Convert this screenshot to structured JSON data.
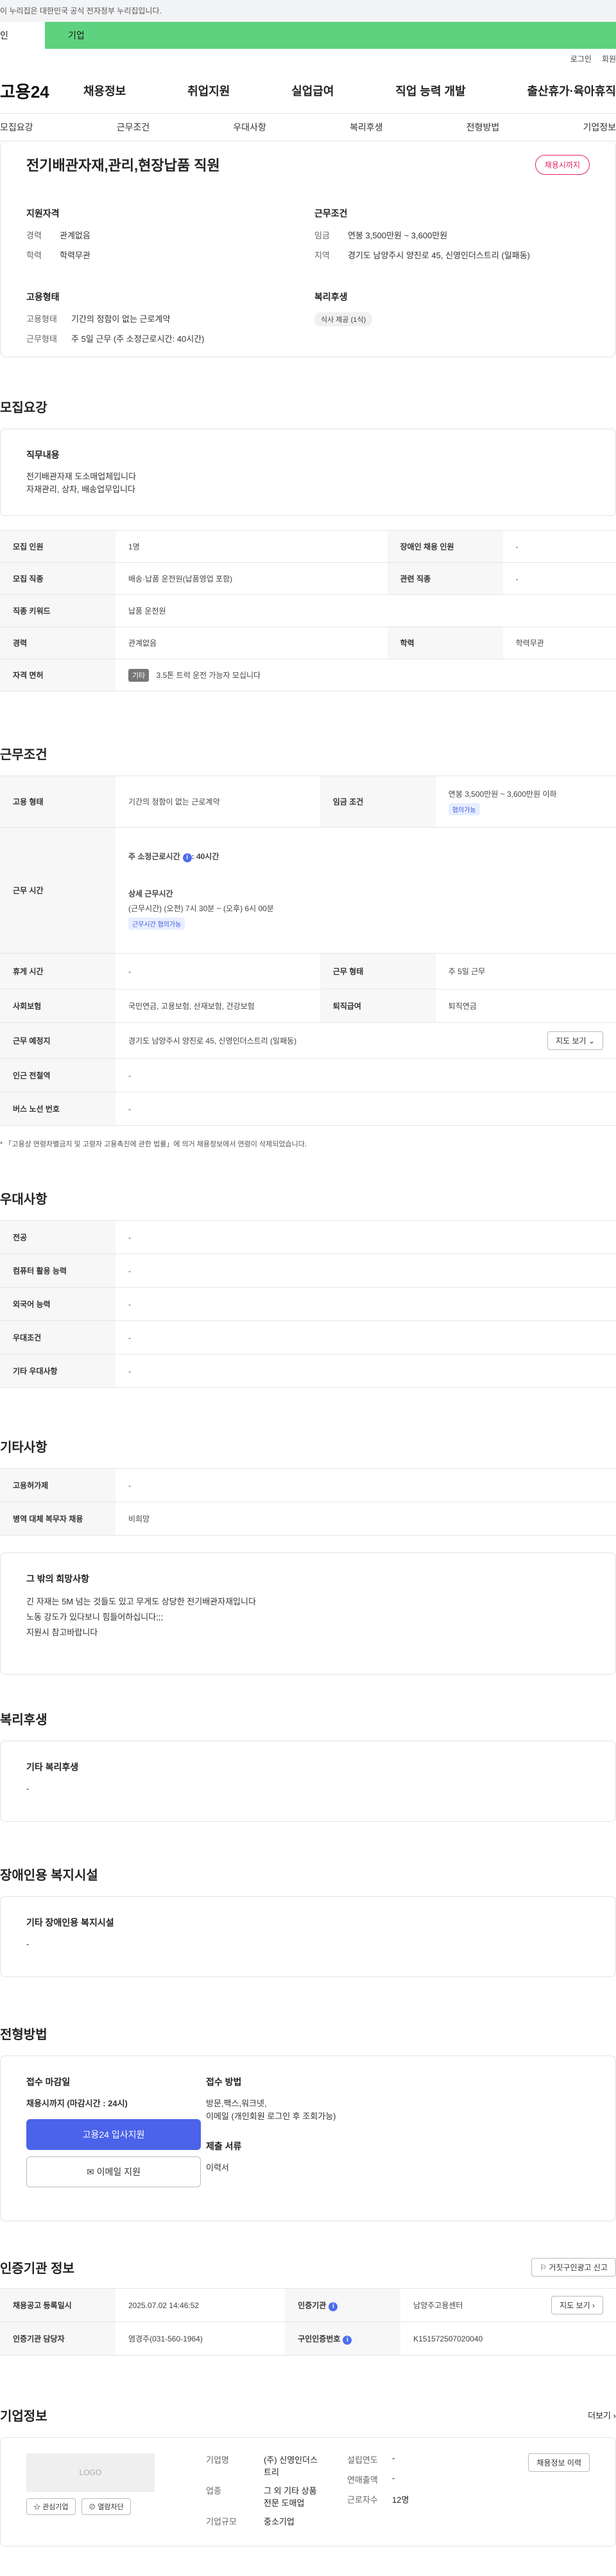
{
  "gov_banner": "이 누리집은 대한민국 공식 전자정부 누리집입니다.",
  "user_tabs": {
    "personal": "인",
    "corporate": "기업"
  },
  "util": {
    "login": "로그인",
    "join": "회원"
  },
  "gnb": {
    "logo": "고용24",
    "items": [
      "채용정보",
      "취업지원",
      "실업급여",
      "직업 능력 개발",
      "출산휴가·육아휴직"
    ]
  },
  "subnav": [
    "모집요강",
    "근무조건",
    "우대사항",
    "복리후생",
    "전형방법",
    "기업정보"
  ],
  "summary": {
    "title": "전기배관자재,관리,현장납품 직원",
    "deadline_badge": "채용시까지",
    "qual": {
      "heading": "지원자격",
      "career_k": "경력",
      "career_v": "관계없음",
      "edu_k": "학력",
      "edu_v": "학력무관"
    },
    "cond": {
      "heading": "근무조건",
      "wage_k": "임금",
      "wage_v": "연봉 3,500만원 ~ 3,600만원",
      "loc_k": "지역",
      "loc_v": "경기도 남양주시 양진로 45, 신영인더스트리 (일패동)"
    },
    "emp": {
      "heading": "고용형태",
      "type_k": "고용형태",
      "type_v": "기간의 정함이 없는 근로계약",
      "work_k": "근무형태",
      "work_v": "주 5일 근무 (주 소정근로시간: 40시간)"
    },
    "welfare": {
      "heading": "복리후생",
      "chip": "식사 제공 (1식)"
    }
  },
  "recruit": {
    "title": "모집요강",
    "duty_heading": "직무내용",
    "duty_lines": [
      "전기배관자재 도소매업체입니다",
      "자재관리, 상차, 배송업무입니다"
    ],
    "rows": {
      "count_k": "모집 인원",
      "count_v": "1명",
      "disabled_k": "장애인 채용 인원",
      "disabled_v": "-",
      "occupation_k": "모집 직종",
      "occupation_v": "배송·납품 운전원(납품영업 포함)",
      "related_k": "관련 직종",
      "related_v": "-",
      "keyword_k": "직종 키워드",
      "keyword_v": "납품 운전원",
      "career_k": "경력",
      "career_v": "관계없음",
      "edu_k": "학력",
      "edu_v": "학력무관",
      "license_k": "자격 면허",
      "license_tag": "기타",
      "license_v": "3.5톤 트럭 운전 가능자 모십니다"
    }
  },
  "work": {
    "title": "근무조건",
    "type_k": "고용 형태",
    "type_v": "기간의 정함이 없는 근로계약",
    "wage_k": "임금 조건",
    "wage_v": "연봉 3,500만원 ~ 3,600만원 이하",
    "wage_chip": "협의가능",
    "hours_k": "근무 시간",
    "hours_main": "주 소정근로시간",
    "hours_main_v": ": 40시간",
    "hours_detail_h": "상세 근무시간",
    "hours_detail_v": "(근무시간) (오전) 7시 30분 ~ (오후) 6시 00분",
    "hours_chip": "근무시간 협의가능",
    "rest_k": "휴게 시간",
    "rest_v": "-",
    "shift_k": "근무 형태",
    "shift_v": "주 5일 근무",
    "ins_k": "사회보험",
    "ins_v": "국민연금, 고용보험, 산재보험, 건강보험",
    "sev_k": "퇴직급여",
    "sev_v": "퇴직연금",
    "place_k": "근무 예정지",
    "place_v": "경기도 남양주시 양진로 45, 신영인더스트리 (일패동)",
    "map_btn": "지도 보기",
    "subway_k": "인근 전철역",
    "subway_v": "-",
    "bus_k": "버스 노선 번호",
    "bus_v": "-",
    "note": "* 「고용상 연령차별금지 및 고령자 고용촉진에 관한 법률」에 의거 채용정보에서 연령이 삭제되었습니다."
  },
  "pref": {
    "title": "우대사항",
    "rows": [
      {
        "k": "전공",
        "v": "-"
      },
      {
        "k": "컴퓨터 활용 능력",
        "v": "-"
      },
      {
        "k": "외국어 능력",
        "v": "-"
      },
      {
        "k": "우대조건",
        "v": "-"
      },
      {
        "k": "기타 우대사항",
        "v": "-"
      }
    ]
  },
  "etc": {
    "title": "기타사항",
    "rows": [
      {
        "k": "고용허가제",
        "v": "-"
      },
      {
        "k": "병역 대체 복무자 채용",
        "v": "비희망"
      }
    ],
    "other_heading": "그 밖의 희망사항",
    "other_lines": [
      "긴 자재는 5M 넘는 것들도 있고 무게도 상당한 전기배관자재입니다",
      "노동 강도가 있다보니 힘들어하십니다;;;",
      "지원시 참고바랍니다"
    ]
  },
  "benefit": {
    "title": "복리후생",
    "heading": "기타 복리후생",
    "value": "-"
  },
  "facility": {
    "title": "장애인용 복지시설",
    "heading": "기타 장애인용 복지시설",
    "value": "-"
  },
  "process": {
    "title": "전형방법",
    "deadline_h": "접수 마감일",
    "deadline_v": "채용시까지 (마감시간 : 24시)",
    "apply_btn": "고용24 입사지원",
    "email_btn": "이메일 지원",
    "method_h": "접수 방법",
    "method_lines": [
      "방문,팩스,워크넷,",
      "이메일 (개인회원 로그인 후 조회가능)"
    ],
    "docs_h": "제출 서류",
    "docs_v": "이력서"
  },
  "cert": {
    "title": "인증기관 정보",
    "report_btn": "거짓구인광고 신고",
    "reg_k": "채용공고 등록일시",
    "reg_v": "2025.07.02 14:46:52",
    "org_k": "인증기관",
    "org_v": "남양주고용센터",
    "org_map_btn": "지도 보기",
    "manager_k": "인증기관 담당자",
    "manager_v": "염경주(031-560-1964)",
    "id_k": "구인인증번호",
    "id_v": "K151572507020040"
  },
  "company": {
    "title": "기업정보",
    "more": "더보기",
    "logo": "LOGO",
    "fav_btn": "관심기업",
    "block_btn": "열람차단",
    "name_k": "기업명",
    "name_v": [
      "(주) 신영인더스",
      "트리"
    ],
    "industry_k": "업종",
    "industry_v": [
      "그 외 기타 상품",
      "전문 도매업"
    ],
    "scale_k": "기업규모",
    "scale_v": "중소기업",
    "founded_k": "설립연도",
    "founded_v": "-",
    "revenue_k": "연매출액",
    "revenue_v": "-",
    "employees_k": "근로자수",
    "employees_v": "12명",
    "jobs_btn": "채용정보 이력"
  }
}
